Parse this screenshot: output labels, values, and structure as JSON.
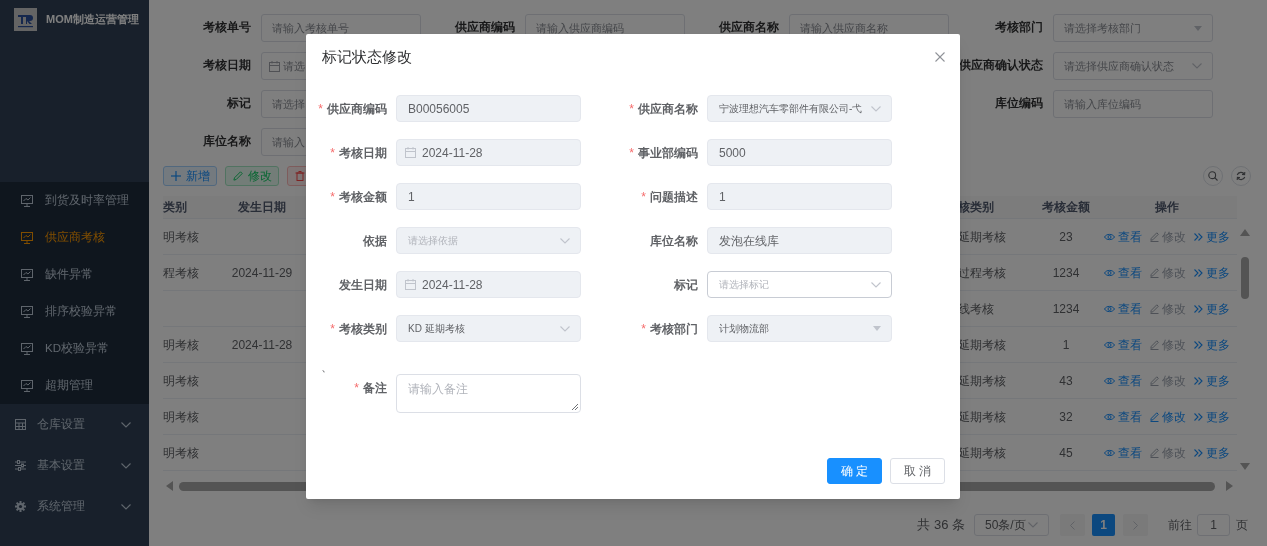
{
  "sidebar": {
    "title": "MOM制造运营管理",
    "items": [
      {
        "kind": "sub",
        "label": "到货及时率管理",
        "selected": false
      },
      {
        "kind": "sub",
        "label": "供应商考核",
        "selected": true
      },
      {
        "kind": "sub",
        "label": "缺件异常",
        "selected": false
      },
      {
        "kind": "sub",
        "label": "排序校验异常",
        "selected": false
      },
      {
        "kind": "sub",
        "label": "KD校验异常",
        "selected": false
      },
      {
        "kind": "sub",
        "label": "超期管理",
        "selected": false
      },
      {
        "kind": "group",
        "label": "仓库设置",
        "expanded": false
      },
      {
        "kind": "group",
        "label": "基本设置",
        "expanded": false
      },
      {
        "kind": "group",
        "label": "系统管理",
        "expanded": false
      }
    ]
  },
  "filters": [
    {
      "label": "考核单号",
      "kind": "text",
      "placeholder": "请输入考核单号"
    },
    {
      "label": "供应商编码",
      "kind": "text",
      "placeholder": "请输入供应商编码"
    },
    {
      "label": "供应商名称",
      "kind": "text",
      "placeholder": "请输入供应商名称"
    },
    {
      "label": "考核部门",
      "kind": "dropdown",
      "placeholder": "请选择考核部门"
    },
    {
      "label": "考核日期",
      "kind": "date",
      "placeholder": "请选"
    },
    {
      "label": "供应商确认状态",
      "kind": "select",
      "placeholder": "请选择供应商确认状态"
    },
    {
      "label": "标记",
      "kind": "text",
      "placeholder": "请选择"
    },
    {
      "label": "库位编码",
      "kind": "text",
      "placeholder": "请输入库位编码"
    },
    {
      "label": "库位名称",
      "kind": "text",
      "placeholder": "请输入"
    }
  ],
  "toolbar": [
    {
      "kind": "add",
      "label": "新增"
    },
    {
      "kind": "edit",
      "label": "修改"
    },
    {
      "kind": "delete"
    }
  ],
  "table": {
    "columns": [
      "类别",
      "发生日期",
      "核类别",
      "考核金额",
      "操作"
    ],
    "rows": [
      {
        "category": "明考核",
        "assessment_type": "延期考核",
        "amount": "23",
        "actions": [
          {
            "kind": "view",
            "label": "查看",
            "disabled": false
          },
          {
            "kind": "edit",
            "label": "修改",
            "disabled": true
          },
          {
            "kind": "more",
            "label": "更多",
            "disabled": false
          }
        ]
      },
      {
        "category": "程考核",
        "date": "2024-11-29",
        "assessment_type": "过程考核",
        "amount": "1234",
        "actions": [
          {
            "kind": "view",
            "label": "查看",
            "disabled": false
          },
          {
            "kind": "edit",
            "label": "修改",
            "disabled": true
          },
          {
            "kind": "more",
            "label": "更多",
            "disabled": false
          }
        ]
      },
      {
        "assessment_type": "线考核",
        "amount": "1234",
        "actions": [
          {
            "kind": "view",
            "label": "查看",
            "disabled": false
          },
          {
            "kind": "edit",
            "label": "修改",
            "disabled": true
          },
          {
            "kind": "more",
            "label": "更多",
            "disabled": false
          }
        ]
      },
      {
        "category": "明考核",
        "date": "2024-11-28",
        "assessment_type": "延期考核",
        "amount": "1",
        "actions": [
          {
            "kind": "view",
            "label": "查看",
            "disabled": false
          },
          {
            "kind": "edit",
            "label": "修改",
            "disabled": true
          },
          {
            "kind": "more",
            "label": "更多",
            "disabled": false
          }
        ]
      },
      {
        "category": "明考核",
        "assessment_type": "延期考核",
        "amount": "43",
        "actions": [
          {
            "kind": "view",
            "label": "查看",
            "disabled": false
          },
          {
            "kind": "edit",
            "label": "修改",
            "disabled": true
          },
          {
            "kind": "more",
            "label": "更多",
            "disabled": false
          }
        ]
      },
      {
        "category": "明考核",
        "assessment_type": "延期考核",
        "amount": "32",
        "actions": [
          {
            "kind": "view",
            "label": "查看",
            "disabled": false
          },
          {
            "kind": "edit",
            "label": "修改",
            "disabled": false
          },
          {
            "kind": "more",
            "label": "更多",
            "disabled": false
          }
        ]
      },
      {
        "category": "明考核",
        "assessment_type": "延期考核",
        "amount": "45",
        "actions": [
          {
            "kind": "view",
            "label": "查看",
            "disabled": false
          },
          {
            "kind": "edit",
            "label": "修改",
            "disabled": true
          },
          {
            "kind": "more",
            "label": "更多",
            "disabled": false
          }
        ]
      }
    ]
  },
  "pagination": {
    "total": "共 36 条",
    "page_size": "50条/页",
    "pages": [
      {
        "label": "1",
        "selected": true
      }
    ],
    "goto": "前往",
    "goto_value": "1",
    "unit": "页"
  },
  "dialog": {
    "title": "标记状态修改",
    "fields": [
      {
        "label": "供应商编码",
        "mark": "*",
        "kind": "text",
        "value": "B00056005",
        "disabled": true
      },
      {
        "label": "供应商名称",
        "mark": "*",
        "kind": "select",
        "value": "宁波理想汽车零部件有限公司-弋",
        "disabled": true
      },
      {
        "label": "考核日期",
        "mark": "*",
        "kind": "date",
        "value": "2024-11-28",
        "disabled": true
      },
      {
        "label": "事业部编码",
        "mark": "*",
        "kind": "text",
        "value": "5000",
        "disabled": true
      },
      {
        "label": "考核金额",
        "mark": "*",
        "kind": "text",
        "value": "1",
        "disabled": true
      },
      {
        "label": "问题描述",
        "mark": "*",
        "kind": "text",
        "value": "1",
        "disabled": true
      },
      {
        "label": "依据",
        "kind": "select",
        "placeholder": "请选择依据",
        "disabled": true
      },
      {
        "label": "库位名称",
        "kind": "text",
        "value": "发泡在线库",
        "disabled": true
      },
      {
        "label": "发生日期",
        "kind": "date",
        "value": "2024-11-28",
        "disabled": true
      },
      {
        "label": "标记",
        "kind": "select",
        "placeholder": "请选择标记",
        "disabled": false
      },
      {
        "label": "考核类别",
        "mark": "*",
        "kind": "select",
        "value": "KD 延期考核",
        "disabled": true
      },
      {
        "label": "考核部门",
        "mark": "*",
        "kind": "dropdown",
        "value": "计划物流部",
        "disabled": true
      }
    ],
    "stray_text": "、",
    "remark": {
      "label": "备注",
      "mark": "*",
      "placeholder": "请输入备注"
    },
    "buttons": [
      {
        "kind": "primary",
        "label": "确 定"
      },
      {
        "kind": "default",
        "label": "取 消"
      }
    ]
  }
}
